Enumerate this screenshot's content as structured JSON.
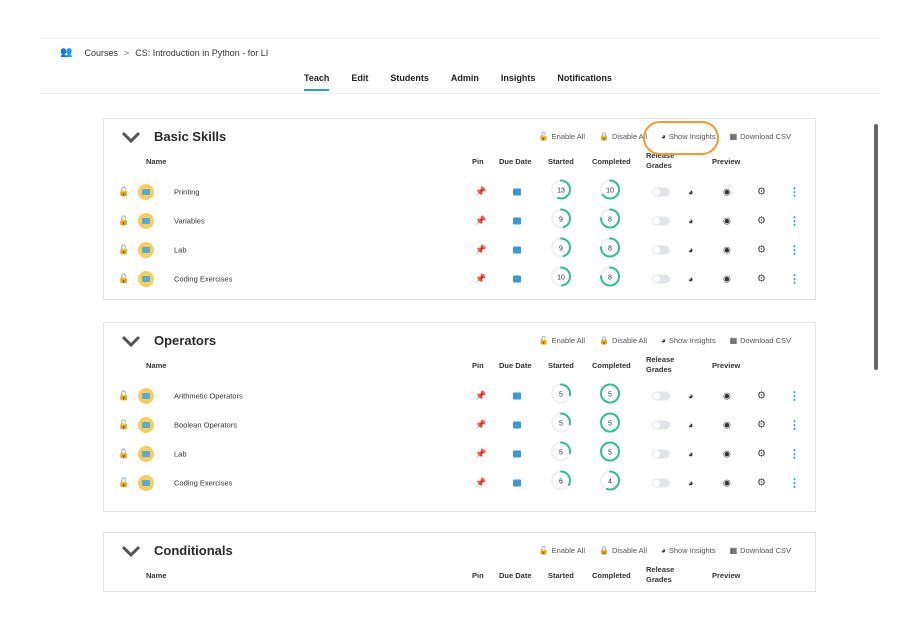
{
  "breadcrumb": {
    "root": "Courses",
    "separator": ">",
    "course": "CS: Introduction in Python - for LI"
  },
  "tabs": [
    {
      "label": "Teach",
      "active": true
    },
    {
      "label": "Edit"
    },
    {
      "label": "Students"
    },
    {
      "label": "Admin"
    },
    {
      "label": "Insights"
    },
    {
      "label": "Notifications"
    }
  ],
  "actions": {
    "enable": "Enable All",
    "disable": "Disable All",
    "insights": "Show Insights",
    "csv": "Download CSV"
  },
  "columns": {
    "name": "Name",
    "pin": "Pin",
    "due": "Due Date",
    "started": "Started",
    "completed": "Completed",
    "release1": "Release",
    "release2": "Grades",
    "preview": "Preview"
  },
  "colors": {
    "accent": "#2a9bd8",
    "progress": "#2fc28a",
    "highlight": "#f39a2e"
  },
  "sections": [
    {
      "title": "Basic Skills",
      "items": [
        {
          "name": "Printing",
          "started": "13",
          "started_frac": 0.55,
          "completed": "10",
          "completed_frac": 0.65
        },
        {
          "name": "Variables",
          "started": "9",
          "started_frac": 0.45,
          "completed": "8",
          "completed_frac": 0.75
        },
        {
          "name": "Lab",
          "started": "9",
          "started_frac": 0.45,
          "completed": "8",
          "completed_frac": 0.75
        },
        {
          "name": "Coding Exercises",
          "started": "10",
          "started_frac": 0.48,
          "completed": "8",
          "completed_frac": 0.75
        }
      ]
    },
    {
      "title": "Operators",
      "items": [
        {
          "name": "Arithmetic Operators",
          "started": "5",
          "started_frac": 0.28,
          "completed": "5",
          "completed_frac": 1.0
        },
        {
          "name": "Boolean Operators",
          "started": "5",
          "started_frac": 0.28,
          "completed": "5",
          "completed_frac": 1.0
        },
        {
          "name": "Lab",
          "started": "5",
          "started_frac": 0.28,
          "completed": "5",
          "completed_frac": 1.0
        },
        {
          "name": "Coding Exercises",
          "started": "6",
          "started_frac": 0.33,
          "completed": "4",
          "completed_frac": 0.55
        }
      ]
    },
    {
      "title": "Conditionals",
      "items": []
    }
  ]
}
